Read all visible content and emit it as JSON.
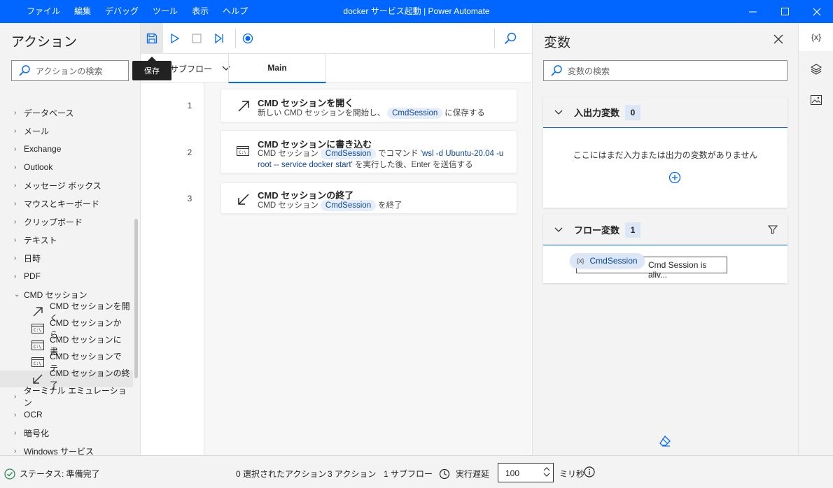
{
  "window": {
    "title": "docker サービス起動 | Power Automate",
    "menu": [
      "ファイル",
      "編集",
      "デバッグ",
      "ツール",
      "表示",
      "ヘルプ"
    ]
  },
  "actions_panel": {
    "title": "アクション",
    "search_placeholder": "アクションの検索",
    "categories": [
      "データベース",
      "メール",
      "Exchange",
      "Outlook",
      "メッセージ ボックス",
      "マウスとキーボード",
      "クリップボード",
      "テキスト",
      "日時",
      "PDF"
    ],
    "expanded_category": "CMD セッション",
    "cmd_items": [
      "CMD セッションを開く",
      "CMD セッションから...",
      "CMD セッションに書...",
      "CMD セッションでテ...",
      "CMD セッションの終了"
    ],
    "after_categories": [
      "ターミナル エミュレーション",
      "OCR",
      "暗号化",
      "Windows サービス"
    ]
  },
  "toolbar": {
    "tooltip": "保存"
  },
  "tabs": {
    "subflow_label": "サブフロー",
    "main_label": "Main"
  },
  "steps": [
    {
      "num": "1",
      "title": "CMD セッションを開く",
      "d1": "新しい CMD セッションを開始し、",
      "var": "CmdSession",
      "d2": "に保存する"
    },
    {
      "num": "2",
      "title": "CMD セッションに書き込む",
      "d1": "CMD セッション",
      "var": "CmdSession",
      "d2": "でコマンド",
      "lit1": "'wsl -d Ubuntu-20.04 -u",
      "lit2": "root -- service docker start'",
      "d3": "を実行した後、Enter を送信する"
    },
    {
      "num": "3",
      "title": "CMD セッションの終了",
      "d1": "CMD セッション",
      "var": "CmdSession",
      "d2": "を終了"
    }
  ],
  "variables_panel": {
    "title": "変数",
    "search_placeholder": "変数の検索",
    "io_section": {
      "name": "入出力変数",
      "count": "0",
      "empty_text": "ここにはまだ入力または出力の変数がありません"
    },
    "flow_section": {
      "name": "フロー変数",
      "count": "1",
      "var_name": "CmdSession",
      "var_value": "Cmd Session is aliv..."
    }
  },
  "side_strip": {
    "variables_icon_text": "{x}"
  },
  "status_bar": {
    "status": "ステータス: 準備完了",
    "selected": "0 選択されたアクション",
    "actions": "3 アクション",
    "subflows": "1 サブフロー",
    "delay_label": "実行遅延",
    "delay_value": "100",
    "unit": "ミリ秒"
  },
  "colors": {
    "accent": "#0066ff",
    "pill_bg": "#e6eefb",
    "status_ok": "#2e8b57"
  }
}
